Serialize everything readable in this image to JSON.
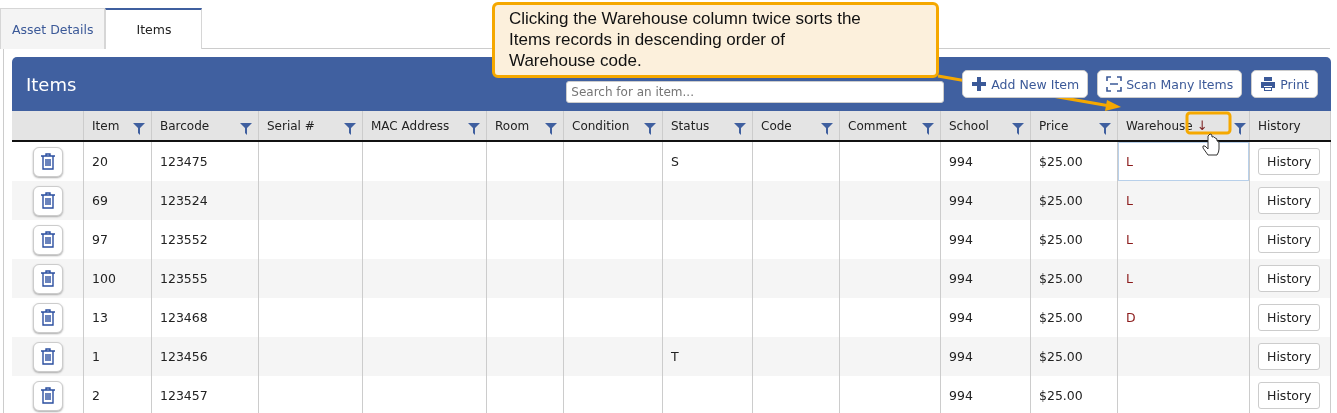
{
  "tabs": [
    {
      "label": "Asset Details",
      "selected": false
    },
    {
      "label": "Items",
      "selected": true
    }
  ],
  "panel": {
    "title": "Items",
    "search": {
      "placeholder": "Search for an item..."
    },
    "buttons": [
      {
        "kind": "add",
        "label": "Add New Item"
      },
      {
        "kind": "scan",
        "label": "Scan Many Items"
      },
      {
        "kind": "print",
        "label": "Print"
      }
    ]
  },
  "callout": {
    "text": "Clicking the Warehouse column twice sorts the Items records in descending order of Warehouse code."
  },
  "table": {
    "columns": [
      {
        "label": "Item",
        "filter": true
      },
      {
        "label": "Barcode",
        "filter": true
      },
      {
        "label": "Serial #",
        "filter": true
      },
      {
        "label": "MAC Address",
        "filter": true
      },
      {
        "label": "Room",
        "filter": true
      },
      {
        "label": "Condition",
        "filter": true
      },
      {
        "label": "Status",
        "filter": true
      },
      {
        "label": "Code",
        "filter": true
      },
      {
        "label": "Comment",
        "filter": true
      },
      {
        "label": "School",
        "filter": true
      },
      {
        "label": "Price",
        "filter": true
      },
      {
        "label": "Warehouse",
        "filter": true,
        "sort_indicator": "↓"
      },
      {
        "label": "History",
        "filter": false
      }
    ],
    "rows": [
      {
        "cells": [
          "20",
          "123475",
          null,
          null,
          null,
          null,
          "S",
          null,
          null,
          "994",
          "$25.00",
          "L"
        ],
        "focused": true,
        "history": "History"
      },
      {
        "cells": [
          "69",
          "123524",
          null,
          null,
          null,
          null,
          null,
          null,
          null,
          "994",
          "$25.00",
          "L"
        ],
        "focused": false,
        "history": "History"
      },
      {
        "cells": [
          "97",
          "123552",
          null,
          null,
          null,
          null,
          null,
          null,
          null,
          "994",
          "$25.00",
          "L"
        ],
        "focused": false,
        "history": "History"
      },
      {
        "cells": [
          "100",
          "123555",
          null,
          null,
          null,
          null,
          null,
          null,
          null,
          "994",
          "$25.00",
          "L"
        ],
        "focused": false,
        "history": "History"
      },
      {
        "cells": [
          "13",
          "123468",
          null,
          null,
          null,
          null,
          null,
          null,
          null,
          "994",
          "$25.00",
          "D"
        ],
        "focused": false,
        "history": "History"
      },
      {
        "cells": [
          "1",
          "123456",
          null,
          null,
          null,
          null,
          "T",
          null,
          null,
          "994",
          "$25.00",
          null
        ],
        "focused": false,
        "history": "History"
      },
      {
        "cells": [
          "2",
          "123457",
          null,
          null,
          null,
          null,
          null,
          null,
          null,
          "994",
          "$25.00",
          null
        ],
        "focused": false,
        "history": "History"
      }
    ]
  }
}
